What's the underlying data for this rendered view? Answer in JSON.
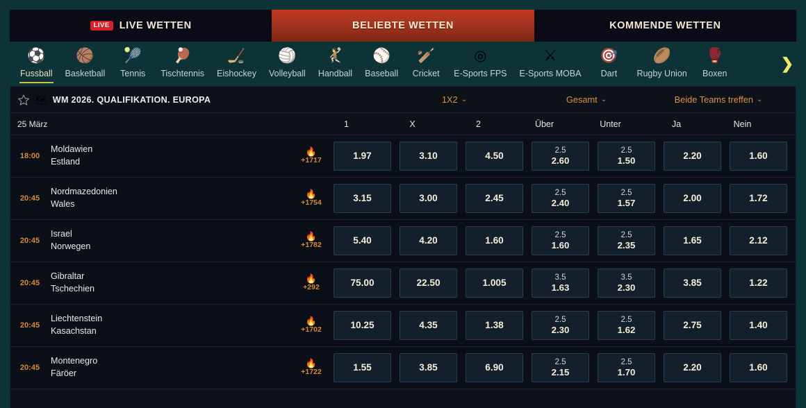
{
  "tabs": [
    {
      "label": "LIVE WETTEN",
      "badge": "LIVE",
      "active": false
    },
    {
      "label": "BELIEBTE WETTEN",
      "badge": "",
      "active": true
    },
    {
      "label": "KOMMENDE WETTEN",
      "badge": "",
      "active": false
    }
  ],
  "sports": [
    {
      "label": "Fussball",
      "icon": "⚽",
      "icon_name": "soccer-ball-icon",
      "active": true
    },
    {
      "label": "Basketball",
      "icon": "🏀",
      "icon_name": "basketball-icon",
      "active": false
    },
    {
      "label": "Tennis",
      "icon": "🎾",
      "icon_name": "tennis-ball-icon",
      "active": false
    },
    {
      "label": "Tischtennis",
      "icon": "🏓",
      "icon_name": "table-tennis-paddle-icon",
      "active": false
    },
    {
      "label": "Eishockey",
      "icon": "🏒",
      "icon_name": "ice-hockey-stick-icon",
      "active": false
    },
    {
      "label": "Volleyball",
      "icon": "🏐",
      "icon_name": "volleyball-icon",
      "active": false
    },
    {
      "label": "Handball",
      "icon": "🤾",
      "icon_name": "handball-player-icon",
      "active": false
    },
    {
      "label": "Baseball",
      "icon": "⚾",
      "icon_name": "baseball-icon",
      "active": false
    },
    {
      "label": "Cricket",
      "icon": "🏏",
      "icon_name": "cricket-bat-icon",
      "active": false
    },
    {
      "label": "E-Sports FPS",
      "icon": "◎",
      "icon_name": "crosshair-target-icon",
      "active": false
    },
    {
      "label": "E-Sports MOBA",
      "icon": "⚔",
      "icon_name": "crossed-swords-icon",
      "active": false
    },
    {
      "label": "Dart",
      "icon": "🎯",
      "icon_name": "dart-icon",
      "active": false
    },
    {
      "label": "Rugby Union",
      "icon": "🏉",
      "icon_name": "rugby-ball-icon",
      "active": false
    },
    {
      "label": "Boxen",
      "icon": "🥊",
      "icon_name": "boxing-glove-icon",
      "active": false
    }
  ],
  "nav_next_icon": "❯",
  "league": {
    "star_icon": "star-outline-icon",
    "globe_icon": "🗺",
    "name": "WM 2026. QUALIFIKATION. EUROPA",
    "selectors": [
      {
        "label": "1X2",
        "chevron": "⌄"
      },
      {
        "label": "Gesamt",
        "chevron": "⌄"
      },
      {
        "label": "Beide Teams treffen",
        "chevron": "⌄"
      }
    ]
  },
  "table": {
    "date": "25 März",
    "columns": [
      "1",
      "X",
      "2",
      "Über",
      "Unter",
      "Ja",
      "Nein"
    ],
    "rows": [
      {
        "time": "18:00",
        "home": "Moldawien",
        "away": "Estland",
        "fire_icon": "🔥",
        "more_count": "+1717",
        "odds": [
          {
            "line": "",
            "value": "1.97"
          },
          {
            "line": "",
            "value": "3.10"
          },
          {
            "line": "",
            "value": "4.50"
          },
          {
            "line": "2.5",
            "value": "2.60"
          },
          {
            "line": "2.5",
            "value": "1.50"
          },
          {
            "line": "",
            "value": "2.20"
          },
          {
            "line": "",
            "value": "1.60"
          }
        ]
      },
      {
        "time": "20:45",
        "home": "Nordmazedonien",
        "away": "Wales",
        "fire_icon": "🔥",
        "more_count": "+1754",
        "odds": [
          {
            "line": "",
            "value": "3.15"
          },
          {
            "line": "",
            "value": "3.00"
          },
          {
            "line": "",
            "value": "2.45"
          },
          {
            "line": "2.5",
            "value": "2.40"
          },
          {
            "line": "2.5",
            "value": "1.57"
          },
          {
            "line": "",
            "value": "2.00"
          },
          {
            "line": "",
            "value": "1.72"
          }
        ]
      },
      {
        "time": "20:45",
        "home": "Israel",
        "away": "Norwegen",
        "fire_icon": "🔥",
        "more_count": "+1782",
        "odds": [
          {
            "line": "",
            "value": "5.40"
          },
          {
            "line": "",
            "value": "4.20"
          },
          {
            "line": "",
            "value": "1.60"
          },
          {
            "line": "2.5",
            "value": "1.60"
          },
          {
            "line": "2.5",
            "value": "2.35"
          },
          {
            "line": "",
            "value": "1.65"
          },
          {
            "line": "",
            "value": "2.12"
          }
        ]
      },
      {
        "time": "20:45",
        "home": "Gibraltar",
        "away": "Tschechien",
        "fire_icon": "🔥",
        "more_count": "+292",
        "odds": [
          {
            "line": "",
            "value": "75.00"
          },
          {
            "line": "",
            "value": "22.50"
          },
          {
            "line": "",
            "value": "1.005"
          },
          {
            "line": "3.5",
            "value": "1.63"
          },
          {
            "line": "3.5",
            "value": "2.30"
          },
          {
            "line": "",
            "value": "3.85"
          },
          {
            "line": "",
            "value": "1.22"
          }
        ]
      },
      {
        "time": "20:45",
        "home": "Liechtenstein",
        "away": "Kasachstan",
        "fire_icon": "🔥",
        "more_count": "+1702",
        "odds": [
          {
            "line": "",
            "value": "10.25"
          },
          {
            "line": "",
            "value": "4.35"
          },
          {
            "line": "",
            "value": "1.38"
          },
          {
            "line": "2.5",
            "value": "2.30"
          },
          {
            "line": "2.5",
            "value": "1.62"
          },
          {
            "line": "",
            "value": "2.75"
          },
          {
            "line": "",
            "value": "1.40"
          }
        ]
      },
      {
        "time": "20:45",
        "home": "Montenegro",
        "away": "Färöer",
        "fire_icon": "🔥",
        "more_count": "+1722",
        "odds": [
          {
            "line": "",
            "value": "1.55"
          },
          {
            "line": "",
            "value": "3.85"
          },
          {
            "line": "",
            "value": "6.90"
          },
          {
            "line": "2.5",
            "value": "2.15"
          },
          {
            "line": "2.5",
            "value": "1.70"
          },
          {
            "line": "",
            "value": "2.20"
          },
          {
            "line": "",
            "value": "1.60"
          }
        ]
      }
    ]
  },
  "colors": {
    "accent_red": "#b83a20",
    "accent_orange": "#dd9147",
    "accent_gold": "#cfc049",
    "page_bg": "#0d3336",
    "panel_bg": "#0c1018"
  }
}
